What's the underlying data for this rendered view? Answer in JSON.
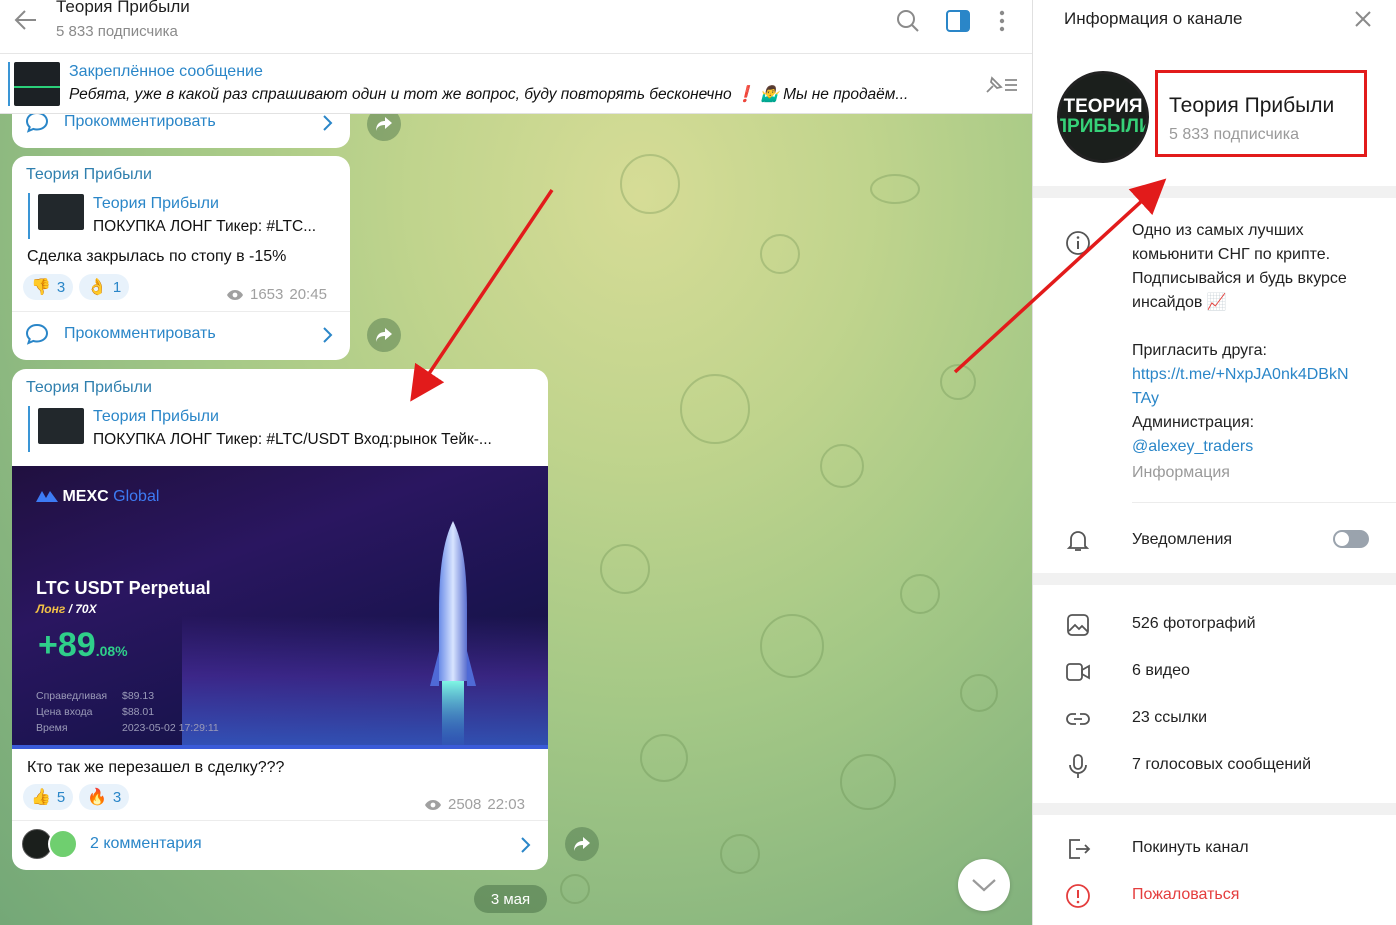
{
  "chat": {
    "title": "Теория Прибыли",
    "subscribers": "5 833 подписчика"
  },
  "pinned": {
    "label": "Закреплённое сообщение",
    "text": "Ребята, уже в какой раз спрашивают один и тот же вопрос, буду повторять бесконечно ❗️ 🤷‍♂️ Мы не продаём..."
  },
  "messages": [
    {
      "comment_label": "Прокомментировать"
    },
    {
      "channel": "Теория Прибыли",
      "forward_from": "Теория Прибыли",
      "forward_text": "ПОКУПКА ЛОНГ   Тикер: #LTC...",
      "text": "Сделка закрылась по стопу в -15%",
      "reactions": [
        {
          "emoji": "👎",
          "count": "3"
        },
        {
          "emoji": "👌",
          "count": "1"
        }
      ],
      "views": "1653",
      "time": "20:45",
      "comment_label": "Прокомментировать"
    },
    {
      "channel": "Теория Прибыли",
      "forward_from": "Теория Прибыли",
      "forward_text": "ПОКУПКА ЛОНГ   Тикер: #LTC/USDT   Вход:рынок   Тейк-...",
      "photo": {
        "brand_main": "MEXC",
        "brand_sub": "Global",
        "pair": "LTC USDT Perpetual",
        "side": "Лонг",
        "leverage": "/ 70X",
        "pnl_main": "+89",
        "pnl_frac": ".08%",
        "rows": [
          {
            "label": "Справедливая",
            "value": "$89.13"
          },
          {
            "label": "Цена входа",
            "value": "$88.01"
          },
          {
            "label": "Время",
            "value": "2023-05-02 17:29:11"
          }
        ]
      },
      "text": "Кто так же перезашел в сделку???",
      "reactions": [
        {
          "emoji": "👍",
          "count": "5"
        },
        {
          "emoji": "🔥",
          "count": "3"
        }
      ],
      "views": "2508",
      "time": "22:03",
      "comment_label": "2 комментария"
    }
  ],
  "date_pill": "3 мая",
  "info": {
    "title": "Информация о канале",
    "name": "Теория Прибыли",
    "subscribers": "5 833 подписчика",
    "avatar_text_1": "ТЕОРИЯ",
    "avatar_text_2": "ПРИБЫЛИ",
    "description": [
      "Одно из самых лучших",
      "комьюнити СНГ по крипте.",
      "Подписывайся и будь вкурсе",
      "инсайдов 📈"
    ],
    "invite_label": "Пригласить друга:",
    "invite_link_1": "https://t.me/+NxpJA0nk4DBkN",
    "invite_link_2": "TAy",
    "admin_label": "Администрация:",
    "admin_handle": "@alexey_traders",
    "info_label": "Информация",
    "notifications": "Уведомления",
    "notifications_on": false,
    "media": {
      "photos": "526 фотографий",
      "videos": "6 видео",
      "links": "23 ссылки",
      "voice": "7 голосовых сообщений"
    },
    "leave": "Покинуть канал",
    "report": "Пожаловаться"
  },
  "colors": {
    "accent": "#2a86c8",
    "highlight_box": "#e21b1b",
    "arrow": "#e21b1b",
    "danger": "#e43d3d"
  }
}
